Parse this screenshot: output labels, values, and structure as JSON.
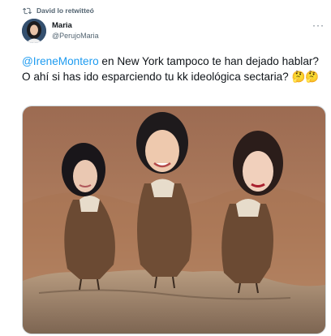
{
  "retweet": {
    "text": "David lo retwitteó",
    "icon": "retweet-icon"
  },
  "author": {
    "name": "Maria",
    "handle": "@PerujoMaria"
  },
  "more_icon": "more-icon",
  "tweet": {
    "mention": "@IreneMontero",
    "body": " en New York tampoco te han dejado hablar? O ahí si  has ido esparciendo tu kk ideológica sectaria? 🤔🤔"
  },
  "colors": {
    "link": "#1d9bf0",
    "secondary_text": "#536471",
    "border": "#cfd9de"
  }
}
